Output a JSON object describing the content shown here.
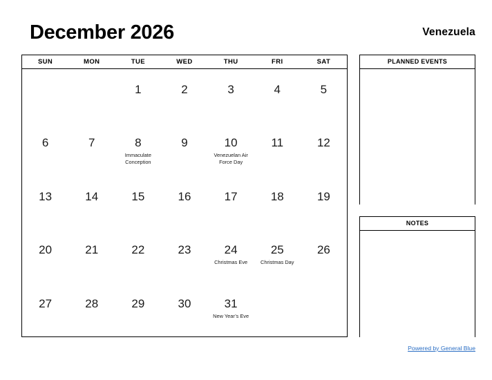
{
  "header": {
    "title": "December 2026",
    "country": "Venezuela"
  },
  "calendar": {
    "weekdays": [
      "SUN",
      "MON",
      "TUE",
      "WED",
      "THU",
      "FRI",
      "SAT"
    ],
    "weeks": [
      [
        {
          "day": "",
          "event": ""
        },
        {
          "day": "",
          "event": ""
        },
        {
          "day": "1",
          "event": ""
        },
        {
          "day": "2",
          "event": ""
        },
        {
          "day": "3",
          "event": ""
        },
        {
          "day": "4",
          "event": ""
        },
        {
          "day": "5",
          "event": ""
        }
      ],
      [
        {
          "day": "6",
          "event": ""
        },
        {
          "day": "7",
          "event": ""
        },
        {
          "day": "8",
          "event": "Immaculate Conception"
        },
        {
          "day": "9",
          "event": ""
        },
        {
          "day": "10",
          "event": "Venezuelan Air Force Day"
        },
        {
          "day": "11",
          "event": ""
        },
        {
          "day": "12",
          "event": ""
        }
      ],
      [
        {
          "day": "13",
          "event": ""
        },
        {
          "day": "14",
          "event": ""
        },
        {
          "day": "15",
          "event": ""
        },
        {
          "day": "16",
          "event": ""
        },
        {
          "day": "17",
          "event": ""
        },
        {
          "day": "18",
          "event": ""
        },
        {
          "day": "19",
          "event": ""
        }
      ],
      [
        {
          "day": "20",
          "event": ""
        },
        {
          "day": "21",
          "event": ""
        },
        {
          "day": "22",
          "event": ""
        },
        {
          "day": "23",
          "event": ""
        },
        {
          "day": "24",
          "event": "Christmas Eve"
        },
        {
          "day": "25",
          "event": "Christmas Day"
        },
        {
          "day": "26",
          "event": ""
        }
      ],
      [
        {
          "day": "27",
          "event": ""
        },
        {
          "day": "28",
          "event": ""
        },
        {
          "day": "29",
          "event": ""
        },
        {
          "day": "30",
          "event": ""
        },
        {
          "day": "31",
          "event": "New Year’s Eve"
        },
        {
          "day": "",
          "event": ""
        },
        {
          "day": "",
          "event": ""
        }
      ]
    ]
  },
  "panels": {
    "planned_events_title": "PLANNED EVENTS",
    "notes_title": "NOTES"
  },
  "footer": {
    "link_text": "Powered by General Blue",
    "link_color": "#2a6ec4"
  }
}
